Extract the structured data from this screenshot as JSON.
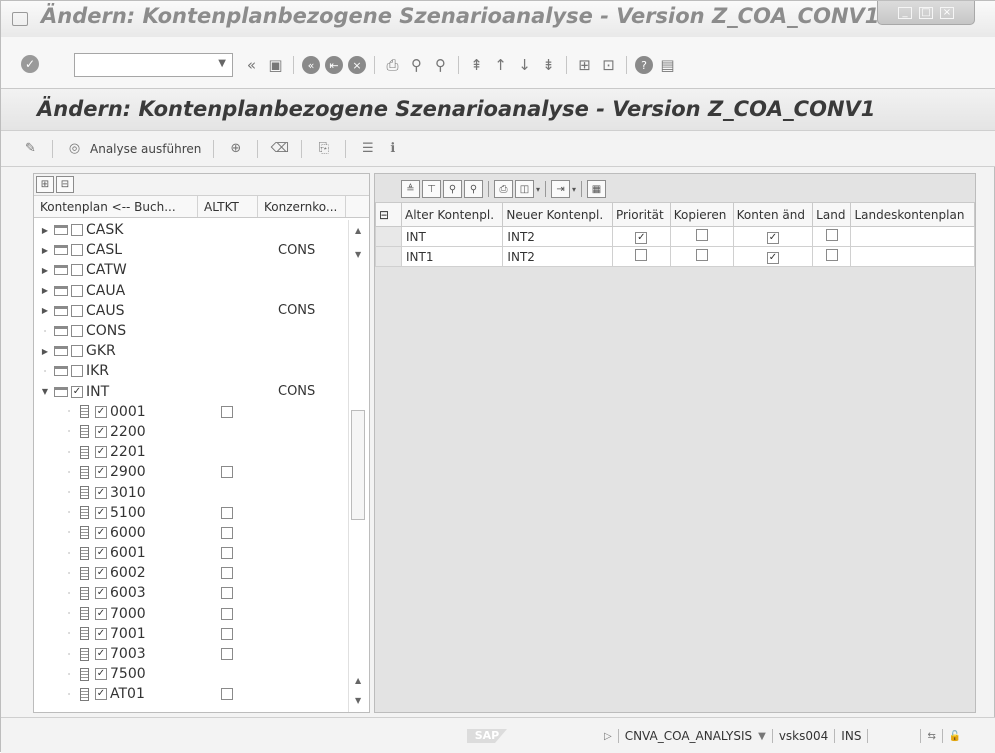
{
  "window": {
    "title": "Ändern: Kontenplanbezogene Szenarioanalyse - Version Z_COA_CONV1"
  },
  "page": {
    "title": "Ändern: Kontenplanbezogene Szenarioanalyse - Version Z_COA_CONV1"
  },
  "command_field": {
    "value": ""
  },
  "app_toolbar": {
    "run_label": "Analyse ausführen"
  },
  "tree": {
    "columns": [
      "Kontenplan <-- Buch...",
      "ALTKT",
      "Konzernko..."
    ],
    "rows": [
      {
        "label": "CASK",
        "kind": "folder",
        "expand": "collapsed",
        "checked": false,
        "altkt": null,
        "konzern": ""
      },
      {
        "label": "CASL",
        "kind": "folder",
        "expand": "collapsed",
        "checked": false,
        "altkt": null,
        "konzern": "CONS"
      },
      {
        "label": "CATW",
        "kind": "folder",
        "expand": "collapsed",
        "checked": false,
        "altkt": null,
        "konzern": ""
      },
      {
        "label": "CAUA",
        "kind": "folder",
        "expand": "collapsed",
        "checked": false,
        "altkt": null,
        "konzern": ""
      },
      {
        "label": "CAUS",
        "kind": "folder",
        "expand": "collapsed",
        "checked": false,
        "altkt": null,
        "konzern": "CONS"
      },
      {
        "label": "CONS",
        "kind": "folder",
        "expand": "leaf",
        "checked": false,
        "altkt": null,
        "konzern": ""
      },
      {
        "label": "GKR",
        "kind": "folder",
        "expand": "collapsed",
        "checked": false,
        "altkt": null,
        "konzern": ""
      },
      {
        "label": "IKR",
        "kind": "folder",
        "expand": "leaf",
        "checked": false,
        "altkt": null,
        "konzern": ""
      },
      {
        "label": "INT",
        "kind": "folder",
        "expand": "expanded",
        "checked": true,
        "altkt": null,
        "konzern": "CONS"
      },
      {
        "label": "0001",
        "kind": "file",
        "expand": "leaf",
        "checked": true,
        "altkt": false,
        "konzern": ""
      },
      {
        "label": "2200",
        "kind": "file",
        "expand": "leaf",
        "checked": true,
        "altkt": null,
        "konzern": ""
      },
      {
        "label": "2201",
        "kind": "file",
        "expand": "leaf",
        "checked": true,
        "altkt": null,
        "konzern": ""
      },
      {
        "label": "2900",
        "kind": "file",
        "expand": "leaf",
        "checked": true,
        "altkt": false,
        "konzern": ""
      },
      {
        "label": "3010",
        "kind": "file",
        "expand": "leaf",
        "checked": true,
        "altkt": null,
        "konzern": ""
      },
      {
        "label": "5100",
        "kind": "file",
        "expand": "leaf",
        "checked": true,
        "altkt": false,
        "konzern": ""
      },
      {
        "label": "6000",
        "kind": "file",
        "expand": "leaf",
        "checked": true,
        "altkt": false,
        "konzern": ""
      },
      {
        "label": "6001",
        "kind": "file",
        "expand": "leaf",
        "checked": true,
        "altkt": false,
        "konzern": ""
      },
      {
        "label": "6002",
        "kind": "file",
        "expand": "leaf",
        "checked": true,
        "altkt": false,
        "konzern": ""
      },
      {
        "label": "6003",
        "kind": "file",
        "expand": "leaf",
        "checked": true,
        "altkt": false,
        "konzern": ""
      },
      {
        "label": "7000",
        "kind": "file",
        "expand": "leaf",
        "checked": true,
        "altkt": false,
        "konzern": ""
      },
      {
        "label": "7001",
        "kind": "file",
        "expand": "leaf",
        "checked": true,
        "altkt": false,
        "konzern": ""
      },
      {
        "label": "7003",
        "kind": "file",
        "expand": "leaf",
        "checked": true,
        "altkt": false,
        "konzern": ""
      },
      {
        "label": "7500",
        "kind": "file",
        "expand": "leaf",
        "checked": true,
        "altkt": null,
        "konzern": ""
      },
      {
        "label": "AT01",
        "kind": "file",
        "expand": "leaf",
        "checked": true,
        "altkt": false,
        "konzern": ""
      }
    ]
  },
  "grid": {
    "columns": [
      "Alter Kontenpl.",
      "Neuer Kontenpl.",
      "Priorität",
      "Kopieren",
      "Konten änd",
      "Land",
      "Landeskontenplan"
    ],
    "rows": [
      {
        "alter": "INT",
        "neuer": "INT2",
        "prioritaet": true,
        "kopieren": false,
        "konten_aend": true,
        "land": false,
        "landeskontenplan": ""
      },
      {
        "alter": "INT1",
        "neuer": "INT2",
        "prioritaet": false,
        "kopieren": false,
        "konten_aend": true,
        "land": false,
        "landeskontenplan": ""
      }
    ]
  },
  "status": {
    "transaction": "CNVA_COA_ANALYSIS",
    "server": "vsks004",
    "mode": "INS"
  }
}
